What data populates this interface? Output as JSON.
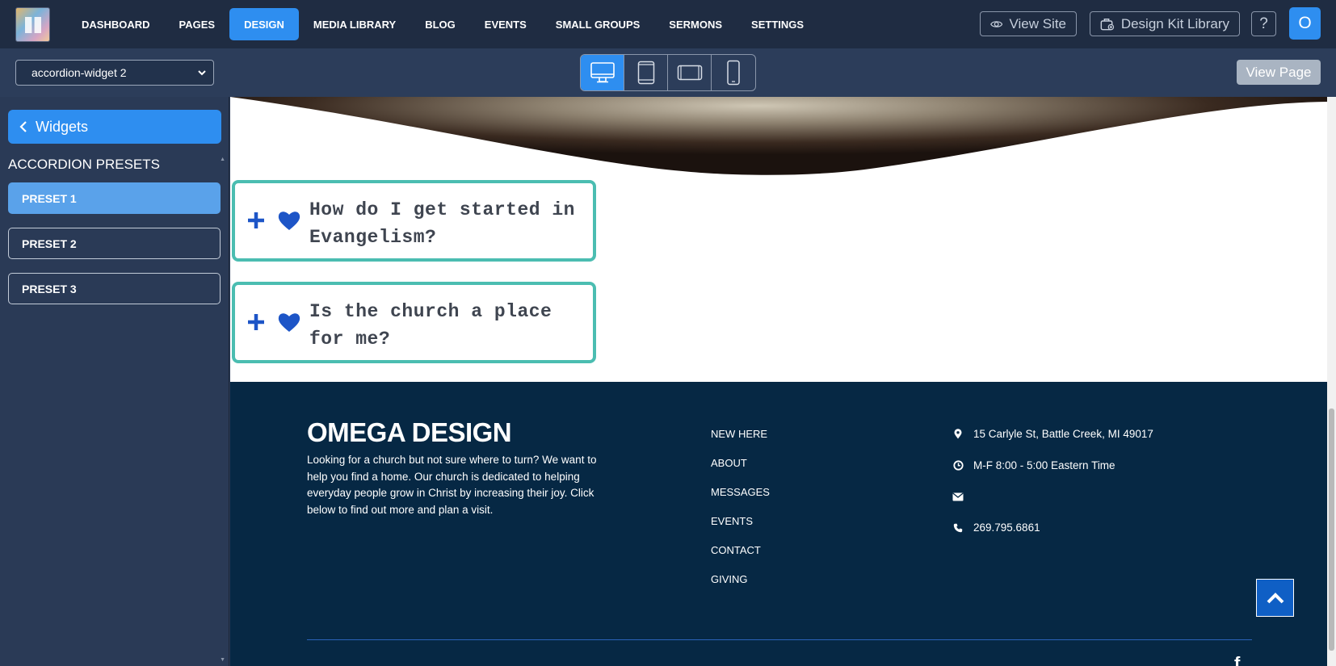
{
  "topbar": {
    "nav": [
      {
        "label": "DASHBOARD",
        "active": false
      },
      {
        "label": "PAGES",
        "active": false
      },
      {
        "label": "DESIGN",
        "active": true
      },
      {
        "label": "MEDIA LIBRARY",
        "active": false
      },
      {
        "label": "BLOG",
        "active": false
      },
      {
        "label": "EVENTS",
        "active": false
      },
      {
        "label": "SMALL GROUPS",
        "active": false
      },
      {
        "label": "SERMONS",
        "active": false
      },
      {
        "label": "SETTINGS",
        "active": false
      }
    ],
    "view_site": "View Site",
    "design_kit_library": "Design Kit Library",
    "help": "?",
    "avatar_initial": "O"
  },
  "subbar": {
    "page_select_value": "accordion-widget 2",
    "view_page": "View Page"
  },
  "sidebar": {
    "back_label": "Widgets",
    "heading": "ACCORDION PRESETS",
    "presets": [
      {
        "label": "PRESET 1",
        "active": true
      },
      {
        "label": "PRESET 2",
        "active": false
      },
      {
        "label": "PRESET 3",
        "active": false
      }
    ]
  },
  "content": {
    "accordions": [
      {
        "title": "How do I get started in Evangelism?"
      },
      {
        "title": "Is the church a place for me?"
      }
    ],
    "footer": {
      "brand": "OMEGA DESIGN",
      "description": "Looking for a church but not sure where to turn? We want to help you find a home. Our church is dedicated to helping everyday people grow in Christ by increasing their joy.  Click below to find out more and plan a visit.",
      "links": [
        "NEW HERE",
        "ABOUT",
        "MESSAGES",
        "EVENTS",
        "CONTACT",
        "GIVING"
      ],
      "address": "15 Carlyle St, Battle Creek, MI 49017",
      "hours": "M-F 8:00 - 5:00 Eastern Time",
      "phone": "269.795.6861",
      "social_glyph": "f"
    }
  },
  "colors": {
    "accent": "#2e8ef0",
    "topbar_bg": "#1f2c42",
    "sidebar_bg": "#2a3a56",
    "accordion_border": "#4bbdb1",
    "accordion_icon": "#1d55c7",
    "footer_bg": "#062844"
  }
}
